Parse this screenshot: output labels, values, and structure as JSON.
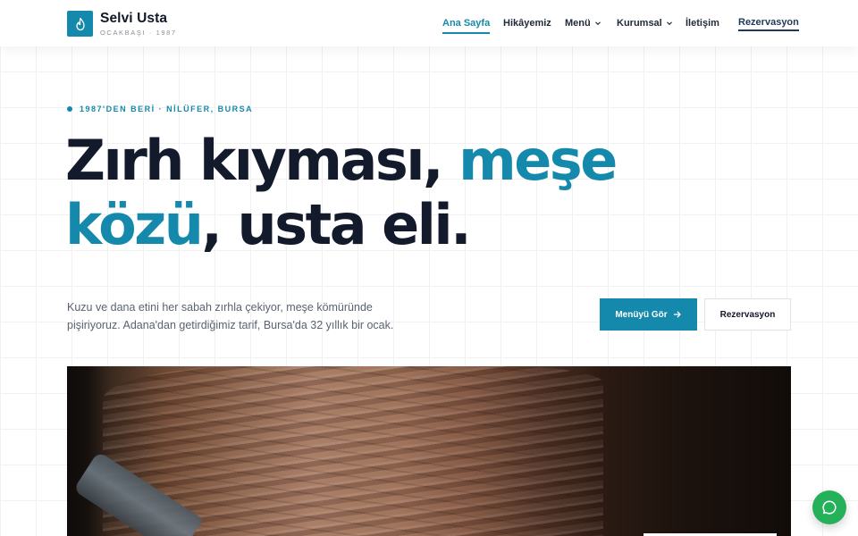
{
  "brand": {
    "name": "Selvi Usta",
    "subtitle": "OCAKBAŞI · 1987",
    "accent_color": "#1589ac"
  },
  "nav": {
    "items": [
      {
        "label": "Ana Sayfa",
        "active": true,
        "dropdown": false
      },
      {
        "label": "Hikâyemiz",
        "active": false,
        "dropdown": false
      },
      {
        "label": "Menü",
        "active": false,
        "dropdown": true
      },
      {
        "label": "Kurumsal",
        "active": false,
        "dropdown": true
      },
      {
        "label": "İletişim",
        "active": false,
        "dropdown": false
      }
    ],
    "cta_label": "Rezervasyon"
  },
  "hero": {
    "eyebrow": "1987'DEN BERİ · NİLÜFER, BURSA",
    "headline_part1": "Zırh kıyması, ",
    "headline_accent1": "meşe",
    "headline_accent2": "közü",
    "headline_part2": ", usta eli.",
    "lead": "Kuzu ve dana etini her sabah zırhla çekiyor, meşe kömüründe pişiriyoruz. Adana'dan getirdiğimiz tarif, Bursa'da 32 yıllık bir ocak.",
    "primary_button": "Menüyü Gör",
    "secondary_button": "Rezervasyon"
  },
  "icons": {
    "logo": "flame-icon",
    "primary_button": "arrow-right-icon",
    "chat": "whatsapp-icon",
    "dropdown": "chevron-down-icon"
  },
  "colors": {
    "chat_button": "#25b05a",
    "heading": "#121a2b"
  }
}
